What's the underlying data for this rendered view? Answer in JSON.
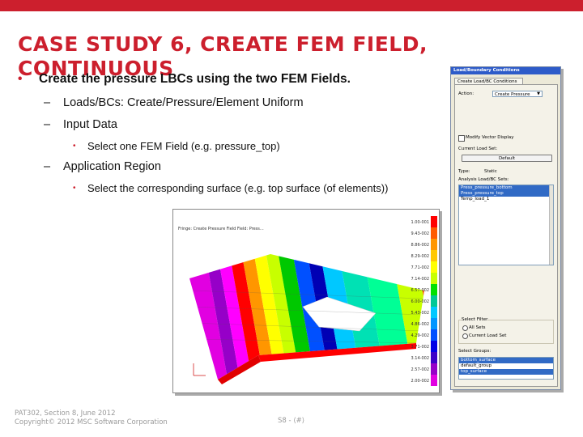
{
  "slide": {
    "title": "CASE STUDY 6, CREATE FEM FIELD, CONTINUOUS",
    "bullets": [
      {
        "text": "Create the pressure LBCs using the two FEM Fields."
      },
      {
        "text": "Loads/BCs: Create/Pressure/Element Uniform"
      },
      {
        "text": "Input Data"
      },
      {
        "text": "Select one FEM Field (e.g. pressure_top)"
      },
      {
        "text": "Application Region"
      },
      {
        "text": "Select the corresponding surface (e.g. top surface (of elements))"
      }
    ],
    "footer": {
      "line1": "PAT302, Section 8, June 2012",
      "line2": "Copyright© 2012 MSC Software Corporation"
    },
    "page": "S8 - ⟨#⟩"
  },
  "fem_view": {
    "header": "Fringe: Create Pressure Field Field: Press...",
    "legend": [
      "1.00-001",
      "9.43-002",
      "8.86-002",
      "8.29-002",
      "7.71-002",
      "7.14-002",
      "6.57-002",
      "6.00-002",
      "5.43-002",
      "4.86-002",
      "4.29-002",
      "3.71-002",
      "3.14-002",
      "2.57-002",
      "2.00-002"
    ],
    "legend_colors": [
      "#ff0000",
      "#ff5a00",
      "#ff9600",
      "#ffc800",
      "#ffff00",
      "#c8ff00",
      "#00e100",
      "#00c896",
      "#00c8ff",
      "#0096ff",
      "#0050ff",
      "#0000e6",
      "#3c00c8",
      "#9600c8",
      "#e100e1"
    ]
  },
  "panel": {
    "title": "Load/Boundary Conditions",
    "tab": "Create Load/BC Conditions",
    "action_label": "Action:",
    "action_value": "Create Pressure",
    "vector_display_label": "Modify Vector Display",
    "current_label": "Current Load Set:",
    "current_btn": "Default",
    "type_label": "Type:",
    "type_value": "Static",
    "existing_label": "Analysis Load/BC Sets:",
    "existing_items": [
      {
        "label": "Press_pressure_bottom",
        "selected": true
      },
      {
        "label": "Press_pressure_top",
        "selected": true
      },
      {
        "label": "Temp_load_1",
        "selected": false
      }
    ],
    "group_label": "Select Filter",
    "radio1": "All Sets",
    "radio2": "Current Load Set",
    "select_group_label": "Select Groups:",
    "groups": [
      {
        "label": "bottom_surface",
        "selected": true
      },
      {
        "label": "default_group",
        "selected": false
      },
      {
        "label": "top_surface",
        "selected": true
      }
    ]
  }
}
